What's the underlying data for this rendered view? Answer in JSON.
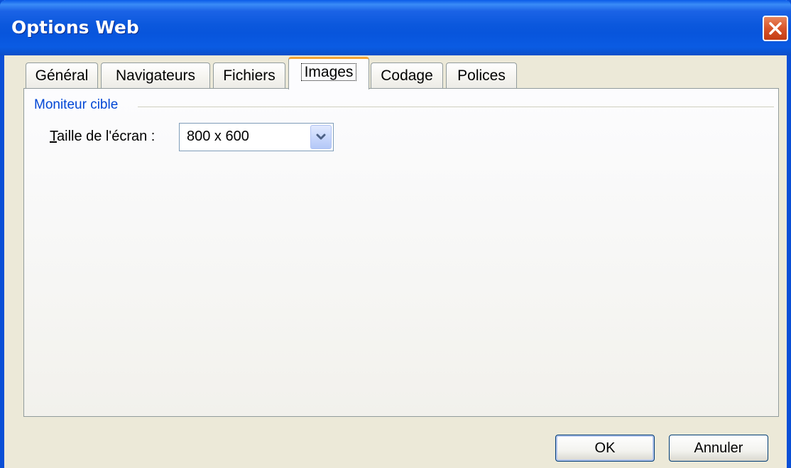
{
  "window": {
    "title": "Options Web"
  },
  "tabs": [
    {
      "label": "Général",
      "active": false
    },
    {
      "label": "Navigateurs",
      "active": false
    },
    {
      "label": "Fichiers",
      "active": false
    },
    {
      "label": "Images",
      "active": true
    },
    {
      "label": "Codage",
      "active": false
    },
    {
      "label": "Polices",
      "active": false
    }
  ],
  "group": {
    "title": "Moniteur cible"
  },
  "screen_size": {
    "label": "Taille de l'écran :",
    "value": "800 x 600"
  },
  "buttons": {
    "ok": "OK",
    "cancel": "Annuler"
  },
  "colors": {
    "titlebar": "#0a5be3",
    "group_title": "#0046d5",
    "active_tab_accent": "#f4a434",
    "close_button": "#d9542a"
  },
  "icons": {
    "close": "close-icon",
    "dropdown": "chevron-down-icon"
  }
}
